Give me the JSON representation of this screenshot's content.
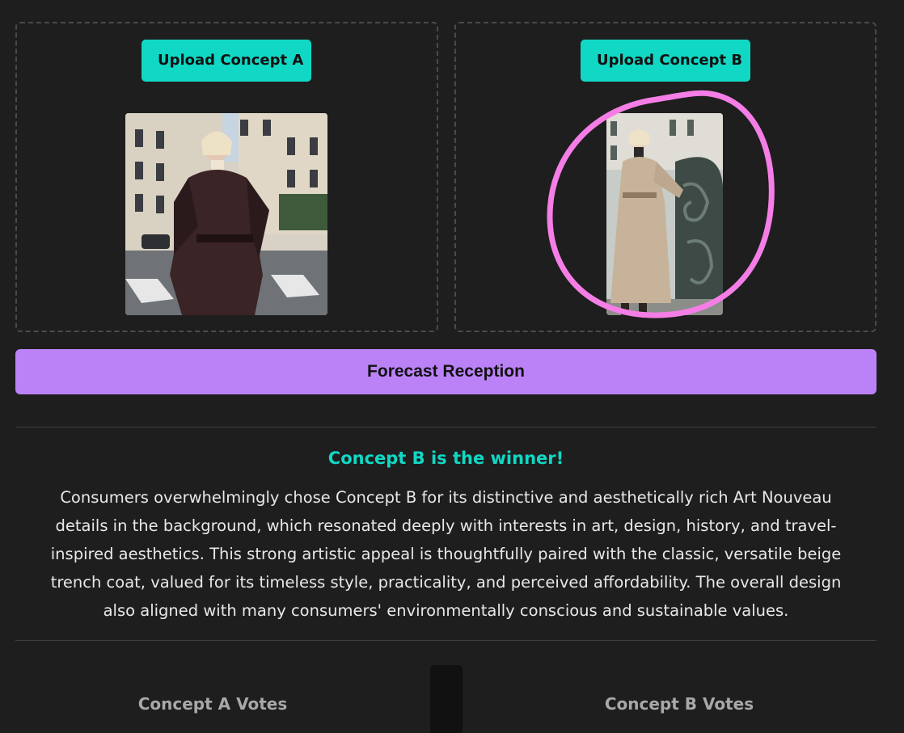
{
  "concept_a": {
    "upload_label": "Upload Concept A"
  },
  "concept_b": {
    "upload_label": "Upload Concept B"
  },
  "forecast_button": "Forecast Reception",
  "result": {
    "winner_title": "Concept B is the winner!",
    "summary": "Consumers overwhelmingly chose Concept B for its distinctive and aesthetically rich Art Nouveau details in the background, which resonated deeply with interests in art, design, history, and travel-inspired aesthetics. This strong artistic appeal is thoughtfully paired with the classic, versatile beige trench coat, valued for its timeless style, practicality, and perceived affordability. The overall design also aligned with many consumers' environmentally conscious and sustainable values."
  },
  "votes": {
    "a_title": "Concept A Votes",
    "b_title": "Concept B Votes"
  },
  "colors": {
    "accent_teal": "#10d8c4",
    "accent_purple": "#bb82f8",
    "annotation_pink": "#f57ee6",
    "background": "#1e1e1e"
  }
}
